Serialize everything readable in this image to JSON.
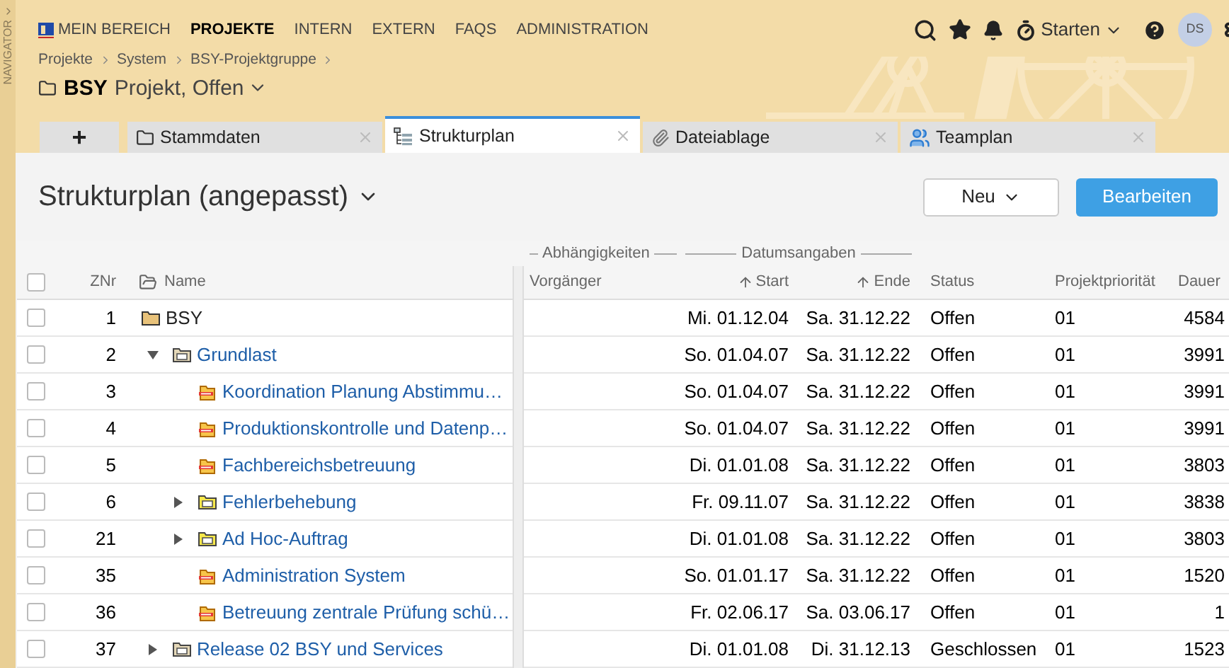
{
  "navigator": {
    "label": "NAVIGATOR"
  },
  "top_nav": [
    {
      "label": "MEIN BEREICH",
      "selected": false
    },
    {
      "label": "PROJEKTE",
      "selected": true
    },
    {
      "label": "INTERN",
      "selected": false
    },
    {
      "label": "EXTERN",
      "selected": false
    },
    {
      "label": "FAQS",
      "selected": false
    },
    {
      "label": "ADMINISTRATION",
      "selected": false
    }
  ],
  "toolbar": {
    "timer_label": "Starten",
    "avatar": "DS"
  },
  "breadcrumbs": [
    "Projekte",
    "System",
    "BSY-Projektgruppe"
  ],
  "project": {
    "name": "BSY",
    "status": "Projekt, Offen"
  },
  "tabs": [
    {
      "kind": "add",
      "label": "+",
      "selected": false
    },
    {
      "kind": "folder",
      "label": "Stammdaten",
      "selected": false
    },
    {
      "kind": "structure",
      "label": "Strukturplan",
      "selected": true
    },
    {
      "kind": "attachment",
      "label": "Dateiablage",
      "selected": false
    },
    {
      "kind": "team",
      "label": "Teamplan",
      "selected": false
    }
  ],
  "view": {
    "title": "Strukturplan (angepasst)",
    "buttons": [
      {
        "kind": "dropdown",
        "label": "Neu"
      },
      {
        "kind": "primary",
        "label": "Bearbeiten"
      }
    ]
  },
  "table": {
    "select_all": {
      "checked": false
    },
    "groups": [
      "Abhängigkeiten",
      "Datumsangaben"
    ],
    "columns": [
      "ZNr",
      "Name",
      "Vorgänger",
      "Start",
      "Ende",
      "Status",
      "Projektpriorität",
      "Dauer"
    ],
    "rows": [
      {
        "checked": false,
        "kind": "project",
        "znr": "1",
        "name": "BSY",
        "start": "Mi. 01.12.04",
        "end": "Sa. 31.12.22",
        "status": "Offen",
        "priority": "01",
        "duration": "4584",
        "children": [
          {
            "checked": false,
            "kind": "group",
            "expanded": true,
            "znr": "2",
            "name": "Grundlast",
            "start": "So. 01.04.07",
            "end": "Sa. 31.12.22",
            "status": "Offen",
            "priority": "01",
            "duration": "3991",
            "children": [
              {
                "checked": false,
                "kind": "task",
                "znr": "3",
                "name": "Koordination Planung Abstimmu…",
                "start": "So. 01.04.07",
                "end": "Sa. 31.12.22",
                "status": "Offen",
                "priority": "01",
                "duration": "3991"
              },
              {
                "checked": false,
                "kind": "task",
                "znr": "4",
                "name": "Produktionskontrolle und Datenp…",
                "start": "So. 01.04.07",
                "end": "Sa. 31.12.22",
                "status": "Offen",
                "priority": "01",
                "duration": "3991"
              },
              {
                "checked": false,
                "kind": "task",
                "znr": "5",
                "name": "Fachbereichsbetreuung",
                "start": "Di. 01.01.08",
                "end": "Sa. 31.12.22",
                "status": "Offen",
                "priority": "01",
                "duration": "3803"
              },
              {
                "checked": false,
                "kind": "subgroup",
                "expanded": false,
                "znr": "6",
                "name": "Fehlerbehebung",
                "start": "Fr. 09.11.07",
                "end": "Sa. 31.12.22",
                "status": "Offen",
                "priority": "01",
                "duration": "3838"
              },
              {
                "checked": false,
                "kind": "subgroup",
                "expanded": false,
                "znr": "21",
                "name": "Ad Hoc-Auftrag",
                "start": "Di. 01.01.08",
                "end": "Sa. 31.12.22",
                "status": "Offen",
                "priority": "01",
                "duration": "3803"
              },
              {
                "checked": false,
                "kind": "task",
                "znr": "35",
                "name": "Administration System",
                "start": "So. 01.01.17",
                "end": "Sa. 31.12.22",
                "status": "Offen",
                "priority": "01",
                "duration": "1520"
              },
              {
                "checked": false,
                "kind": "task",
                "znr": "36",
                "name": "Betreuung zentrale Prüfung schü…",
                "start": "Fr. 02.06.17",
                "end": "Sa. 03.06.17",
                "status": "Offen",
                "priority": "01",
                "duration": "1"
              }
            ]
          },
          {
            "checked": false,
            "kind": "group",
            "expanded": false,
            "znr": "37",
            "name": "Release 02 BSY und Services",
            "start": "Di. 01.01.08",
            "end": "Di. 31.12.13",
            "status": "Geschlossen",
            "priority": "01",
            "duration": "1523"
          }
        ]
      }
    ]
  }
}
